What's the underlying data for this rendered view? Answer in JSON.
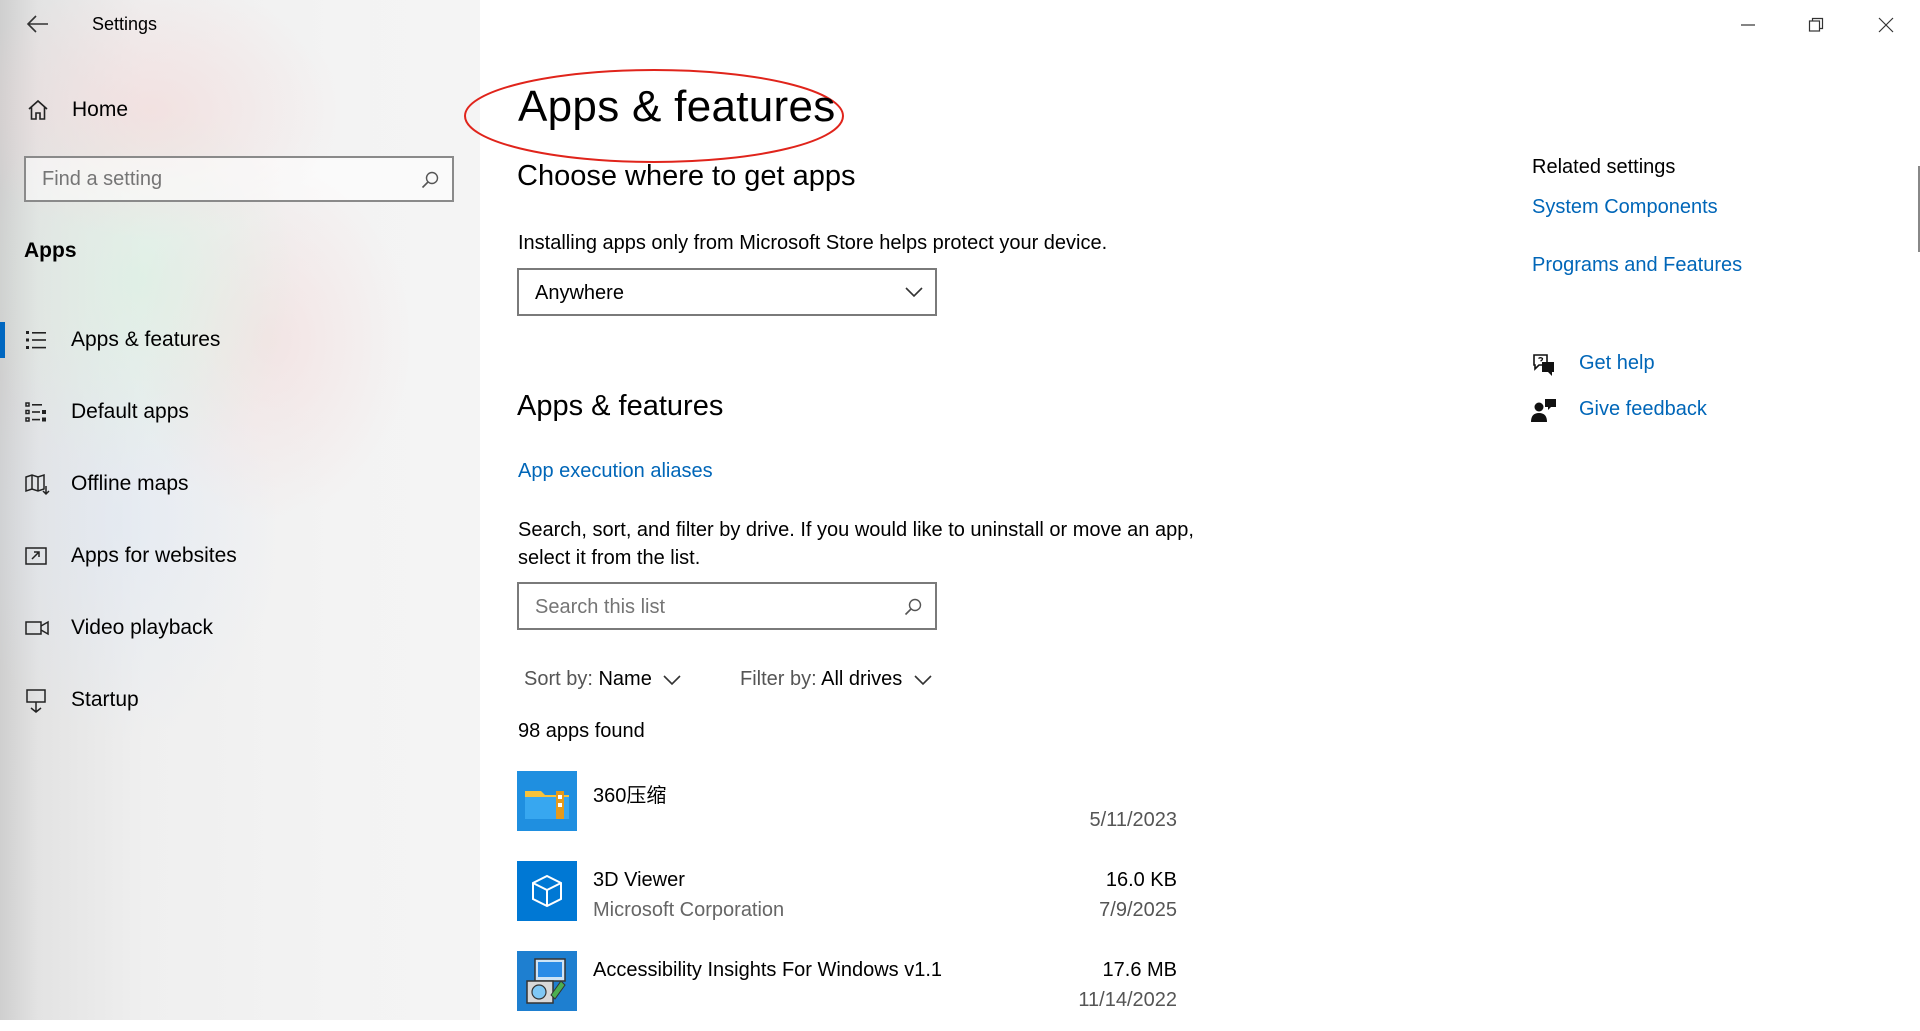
{
  "window": {
    "title": "Settings"
  },
  "sidebar": {
    "home_label": "Home",
    "search_placeholder": "Find a setting",
    "section_heading": "Apps",
    "items": [
      {
        "label": "Apps & features",
        "icon": "apps-features-icon",
        "active": true
      },
      {
        "label": "Default apps",
        "icon": "default-apps-icon",
        "active": false
      },
      {
        "label": "Offline maps",
        "icon": "offline-maps-icon",
        "active": false
      },
      {
        "label": "Apps for websites",
        "icon": "apps-for-websites-icon",
        "active": false
      },
      {
        "label": "Video playback",
        "icon": "video-playback-icon",
        "active": false
      },
      {
        "label": "Startup",
        "icon": "startup-icon",
        "active": false
      }
    ]
  },
  "main": {
    "title": "Apps & features",
    "choose_heading": "Choose where to get apps",
    "install_description": "Installing apps only from Microsoft Store helps protect your device.",
    "source_value": "Anywhere",
    "apps_heading": "Apps & features",
    "aliases_link": "App execution aliases",
    "filter_description": "Search, sort, and filter by drive. If you would like to uninstall or move an app, select it from the list.",
    "list_search_placeholder": "Search this list",
    "sort_label": "Sort by:",
    "sort_value": "Name",
    "filter_label": "Filter by:",
    "filter_value": "All drives",
    "apps_count": "98 apps found",
    "apps": [
      {
        "name": "360压缩",
        "publisher": "",
        "size": "",
        "date": "5/11/2023",
        "icon": "folder-zip-icon"
      },
      {
        "name": "3D Viewer",
        "publisher": "Microsoft Corporation",
        "size": "16.0 KB",
        "date": "7/9/2025",
        "icon": "3d-cube-icon"
      },
      {
        "name": "Accessibility Insights For Windows v1.1",
        "publisher": "",
        "size": "17.6 MB",
        "date": "11/14/2022",
        "icon": "installer-icon"
      }
    ]
  },
  "related": {
    "heading": "Related settings",
    "links": [
      "System Components",
      "Programs and Features"
    ],
    "get_help": "Get help",
    "give_feedback": "Give feedback"
  },
  "colors": {
    "accent": "#0067c0",
    "link": "#0066b8",
    "annotation": "#e0241b"
  }
}
